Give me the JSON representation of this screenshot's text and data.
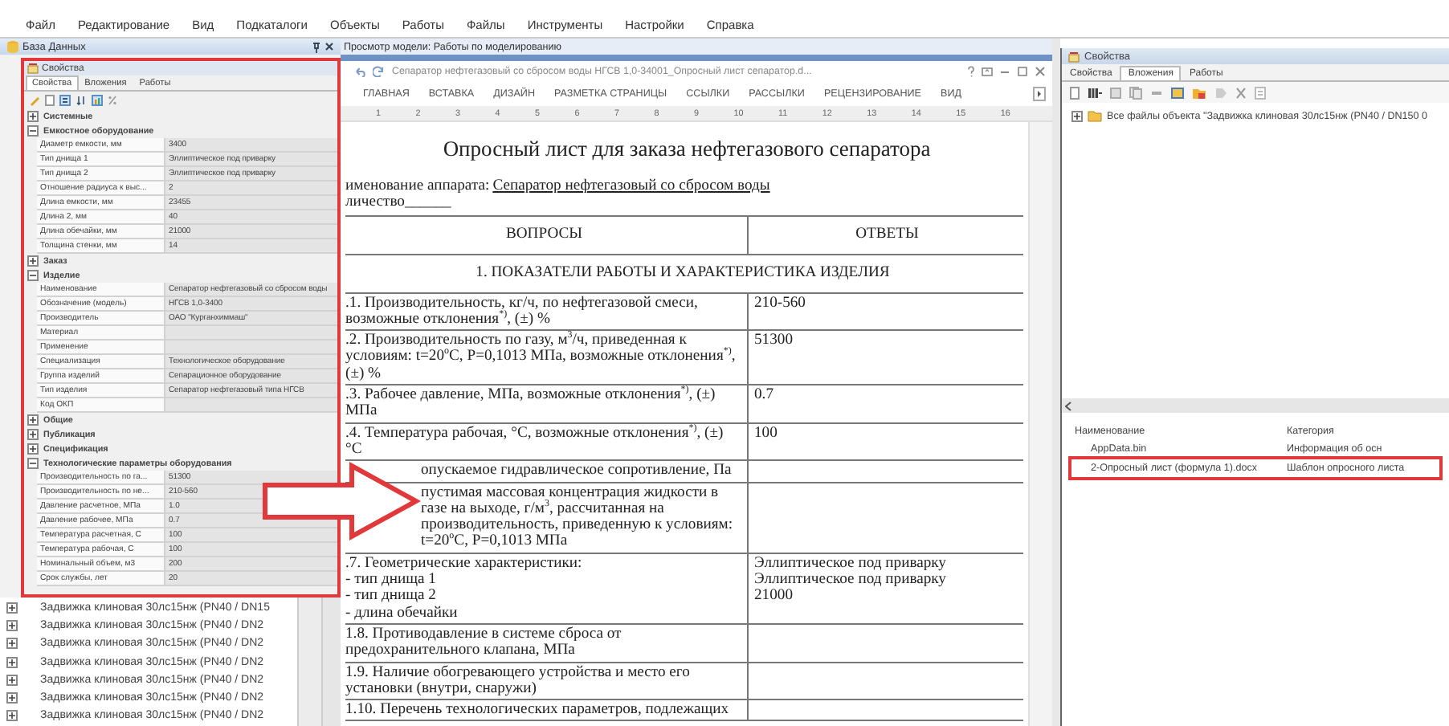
{
  "menu": [
    "Файл",
    "Редактирование",
    "Вид",
    "Подкаталоги",
    "Объекты",
    "Работы",
    "Файлы",
    "Инструменты",
    "Настройки",
    "Справка"
  ],
  "db_pane": {
    "title": "База Данных",
    "tree": [
      "Задвижка клиновая 30лс15нж (PN40 / DN15",
      "Задвижка клиновая 30лс15нж (PN40 / DN2",
      "Задвижка клиновая 30лс15нж (PN40 / DN2",
      "Задвижка клиновая 30лс15нж (PN40 / DN2",
      "Задвижка клиновая 30лс15нж (PN40 / DN2",
      "Задвижка клиновая 30лс15нж (PN40 / DN2",
      "Задвижка клиновая 30лс15нж (PN40 / DN2"
    ]
  },
  "properties_panel": {
    "title": "Свойства",
    "tabs": [
      {
        "label": "Свойства",
        "selected": true
      },
      {
        "label": "Вложения",
        "selected": false
      },
      {
        "label": "Работы",
        "selected": false
      }
    ],
    "groups": [
      {
        "name": "Системные",
        "expanded": false
      },
      {
        "name": "Емкостное оборудование",
        "expanded": true,
        "rows": [
          {
            "name": "Диаметр емкости, мм",
            "value": "3400"
          },
          {
            "name": "Тип днища 1",
            "value": "Эллиптическое под приварку"
          },
          {
            "name": "Тип днища 2",
            "value": "Эллиптическое под приварку"
          },
          {
            "name": "Отношение радиуса к выс...",
            "value": "2"
          },
          {
            "name": "Длина емкости, мм",
            "value": "23455"
          },
          {
            "name": "Длина 2, мм",
            "value": "40"
          },
          {
            "name": "Длина обечайки, мм",
            "value": "21000"
          },
          {
            "name": "Толщина стенки, мм",
            "value": "14"
          }
        ]
      },
      {
        "name": "Заказ",
        "expanded": false
      },
      {
        "name": "Изделие",
        "expanded": true,
        "rows": [
          {
            "name": "Наименование",
            "value": "Сепаратор нефтегазовый со сбросом воды"
          },
          {
            "name": "Обозначение (модель)",
            "value": "НГСВ 1,0-3400"
          },
          {
            "name": "Производитель",
            "value": "ОАО \"Курганхиммаш\""
          },
          {
            "name": "Материал"
          },
          {
            "name": "Применение"
          },
          {
            "name": "Специализация",
            "value": "Технологическое оборудование"
          },
          {
            "name": "Группа изделий",
            "value": "Сепарационное оборудование"
          },
          {
            "name": "Тип изделия",
            "value": "Сепаратор нефтегазовый типа НГСВ"
          },
          {
            "name": "Код ОКП"
          }
        ]
      },
      {
        "name": "Общие",
        "expanded": false
      },
      {
        "name": "Публикация",
        "expanded": false
      },
      {
        "name": "Спецификация",
        "expanded": false
      },
      {
        "name": "Технологические параметры оборудования",
        "expanded": true,
        "rows": [
          {
            "name": "Производительность по га...",
            "value": "51300"
          },
          {
            "name": "Производительность по не...",
            "value": "210-560"
          },
          {
            "name": "Давление расчетное, МПа",
            "value": "1.0"
          },
          {
            "name": "Давление рабочее, МПа",
            "value": "0.7"
          },
          {
            "name": "Температура расчетная, С",
            "value": "100"
          },
          {
            "name": "Температура рабочая, С",
            "value": "100"
          },
          {
            "name": "Номинальный объем, м3",
            "value": "200"
          },
          {
            "name": "Срок службы, лет",
            "value": "20"
          }
        ]
      }
    ]
  },
  "model_tab": {
    "title": "Просмотр модели: Работы по моделированию"
  },
  "word": {
    "title": "Сепаратор нефтегазовый со сбросом воды НГСВ 1,0-34001_Опросный лист сепаратор.d...",
    "ribbon_tabs": [
      "ГЛАВНАЯ",
      "ВСТАВКА",
      "ДИЗАЙН",
      "РАЗМЕТКА СТРАНИЦЫ",
      "ССЫЛКИ",
      "РАССЫЛКИ",
      "РЕЦЕНЗИРОВАНИЕ",
      "ВИД"
    ],
    "ruler": [
      "1",
      "2",
      "3",
      "4",
      "5",
      "6",
      "7",
      "8",
      "9",
      "10",
      "11",
      "12",
      "13",
      "14",
      "15",
      "16"
    ],
    "doc": {
      "heading": "Опросный лист для заказа нефтегазового сепаратора",
      "apparatus_label": "именование аппарата:",
      "apparatus_value": "Сепаратор нефтегазовый со сбросом воды",
      "quantity": "личество______",
      "columns": [
        "ВОПРОСЫ",
        "ОТВЕТЫ"
      ],
      "section": "1. ПОКАЗАТЕЛИ РАБОТЫ И ХАРАКТЕРИСТИКА ИЗДЕЛИЯ",
      "rows": [
        {
          "kind": "plain",
          "question": [
            ".1. Производительность, кг/ч, по нефтегазовой смеси, возможные отклонения$^{*)}$, (±) %"
          ],
          "answer": [
            "210-560"
          ]
        },
        {
          "kind": "plain",
          "question": [
            ".2. Производительность по газу, м$^{3}$/ч, приведенная к условиям: t=20$^{о}$С, P=0,1013 МПа, возможные отклонения$^{*)}$, (±) %"
          ],
          "answer": [
            "51300"
          ]
        },
        {
          "kind": "plain",
          "question": [
            ".3. Рабочее давление, МПа, возможные отклонения$^{*)}$, (±) МПа"
          ],
          "answer": [
            "0.7"
          ]
        },
        {
          "kind": "plain",
          "question": [
            ".4. Температура рабочая, °С, возможные отклонения$^{*)}$, (±) °С"
          ],
          "answer": [
            "100"
          ]
        },
        {
          "kind": "covered",
          "question": [
            "опускаемое гидравлическое сопротивление, Па"
          ]
        },
        {
          "kind": "covered",
          "question": [
            "пустимая массовая концентрация жидкости в газе на выходе, г/м$^{3}$, рассчитанная на производительность, приведенную к условиям: t=20$^{о}$С, P=0,1013 МПа"
          ]
        },
        {
          "kind": "plain",
          "question": [
            ".7. Геометрические характеристики:",
            "- тип днища 1",
            "- тип днища 2",
            "- длина обечайки"
          ],
          "answer": [
            "Эллиптическое под приварку",
            "Эллиптическое под приварку",
            "21000"
          ]
        },
        {
          "kind": "plain",
          "question": [
            "1.8. Противодавление в системе сброса от предохранительного клапана, МПа"
          ]
        },
        {
          "kind": "plain",
          "question": [
            "1.9. Наличие обогревающего устройства и место его установки (внутри, снаружи)"
          ]
        },
        {
          "kind": "plain",
          "question": [
            "1.10. Перечень технологических параметров, подлежащих"
          ]
        }
      ]
    }
  },
  "attachments_panel": {
    "title": "Свойства",
    "tabs": [
      {
        "label": "Свойства",
        "selected": false
      },
      {
        "label": "Вложения",
        "selected": true
      },
      {
        "label": "Работы",
        "selected": false
      }
    ],
    "tree": [
      {
        "label": "Все файлы объекта \"Задвижка клиновая 30лс15нж (PN40 / DN150 0",
        "expanded": false
      }
    ],
    "columns": [
      "Наименование",
      "Категория"
    ],
    "rows": [
      {
        "name": "AppData.bin",
        "category": "Информация об осн",
        "marked": false
      },
      {
        "name": "2-Опросный лист (формула 1).docx",
        "category": "Шаблон опросного листа",
        "marked": true
      }
    ]
  }
}
